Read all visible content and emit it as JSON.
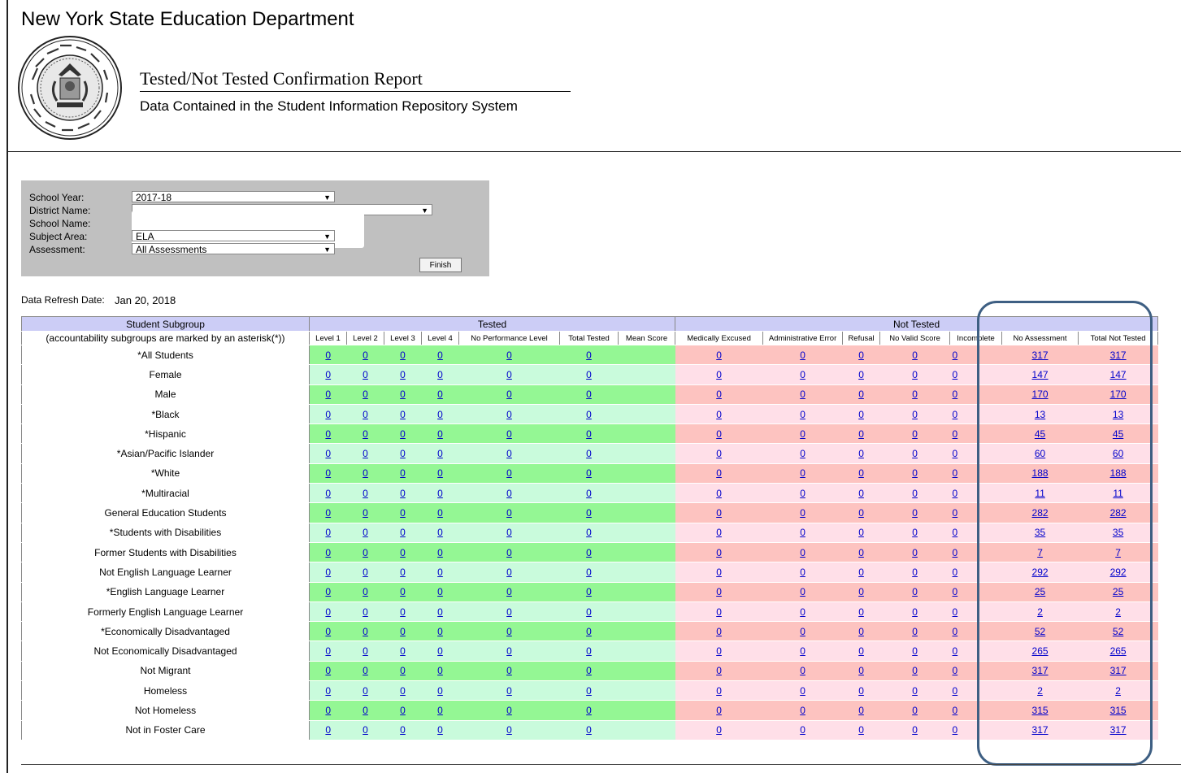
{
  "header": {
    "agency": "New York State Education Department",
    "report_title": "Tested/Not Tested Confirmation Report",
    "report_subtitle": "Data Contained in the Student Information Repository System"
  },
  "filters": {
    "school_year_label": "School Year:",
    "school_year_value": "2017-18",
    "district_label": "District Name:",
    "school_label": "School Name:",
    "subject_label": "Subject Area:",
    "subject_value": "ELA",
    "assessment_label": "Assessment:",
    "assessment_value": "All Assessments",
    "finish_label": "Finish"
  },
  "refresh": {
    "label": "Data Refresh Date:",
    "value": "Jan 20, 2018"
  },
  "table": {
    "group_headers": {
      "subgroup": "Student Subgroup",
      "tested": "Tested",
      "not_tested": "Not Tested"
    },
    "subgroup_note": "(accountability subgroups are marked by an asterisk(*))",
    "columns": [
      "Level 1",
      "Level 2",
      "Level 3",
      "Level 4",
      "No Performance Level",
      "Total Tested",
      "Mean Score",
      "Medically Excused",
      "Administrative Error",
      "Refusal",
      "No Valid Score",
      "Incomplete",
      "No Assessment",
      "Total Not Tested"
    ],
    "rows": [
      {
        "label": "*All Students",
        "values": [
          "0",
          "0",
          "0",
          "0",
          "0",
          "0",
          "",
          "0",
          "0",
          "0",
          "0",
          "0",
          "317",
          "317"
        ]
      },
      {
        "label": "Female",
        "values": [
          "0",
          "0",
          "0",
          "0",
          "0",
          "0",
          "",
          "0",
          "0",
          "0",
          "0",
          "0",
          "147",
          "147"
        ]
      },
      {
        "label": "Male",
        "values": [
          "0",
          "0",
          "0",
          "0",
          "0",
          "0",
          "",
          "0",
          "0",
          "0",
          "0",
          "0",
          "170",
          "170"
        ]
      },
      {
        "label": "*Black",
        "values": [
          "0",
          "0",
          "0",
          "0",
          "0",
          "0",
          "",
          "0",
          "0",
          "0",
          "0",
          "0",
          "13",
          "13"
        ]
      },
      {
        "label": "*Hispanic",
        "values": [
          "0",
          "0",
          "0",
          "0",
          "0",
          "0",
          "",
          "0",
          "0",
          "0",
          "0",
          "0",
          "45",
          "45"
        ]
      },
      {
        "label": "*Asian/Pacific Islander",
        "values": [
          "0",
          "0",
          "0",
          "0",
          "0",
          "0",
          "",
          "0",
          "0",
          "0",
          "0",
          "0",
          "60",
          "60"
        ]
      },
      {
        "label": "*White",
        "values": [
          "0",
          "0",
          "0",
          "0",
          "0",
          "0",
          "",
          "0",
          "0",
          "0",
          "0",
          "0",
          "188",
          "188"
        ]
      },
      {
        "label": "*Multiracial",
        "values": [
          "0",
          "0",
          "0",
          "0",
          "0",
          "0",
          "",
          "0",
          "0",
          "0",
          "0",
          "0",
          "11",
          "11"
        ]
      },
      {
        "label": "General Education Students",
        "values": [
          "0",
          "0",
          "0",
          "0",
          "0",
          "0",
          "",
          "0",
          "0",
          "0",
          "0",
          "0",
          "282",
          "282"
        ]
      },
      {
        "label": "*Students with Disabilities",
        "values": [
          "0",
          "0",
          "0",
          "0",
          "0",
          "0",
          "",
          "0",
          "0",
          "0",
          "0",
          "0",
          "35",
          "35"
        ]
      },
      {
        "label": "Former Students with Disabilities",
        "values": [
          "0",
          "0",
          "0",
          "0",
          "0",
          "0",
          "",
          "0",
          "0",
          "0",
          "0",
          "0",
          "7",
          "7"
        ]
      },
      {
        "label": "Not English Language Learner",
        "values": [
          "0",
          "0",
          "0",
          "0",
          "0",
          "0",
          "",
          "0",
          "0",
          "0",
          "0",
          "0",
          "292",
          "292"
        ]
      },
      {
        "label": "*English Language Learner",
        "values": [
          "0",
          "0",
          "0",
          "0",
          "0",
          "0",
          "",
          "0",
          "0",
          "0",
          "0",
          "0",
          "25",
          "25"
        ]
      },
      {
        "label": "Formerly English Language Learner",
        "values": [
          "0",
          "0",
          "0",
          "0",
          "0",
          "0",
          "",
          "0",
          "0",
          "0",
          "0",
          "0",
          "2",
          "2"
        ]
      },
      {
        "label": "*Economically Disadvantaged",
        "values": [
          "0",
          "0",
          "0",
          "0",
          "0",
          "0",
          "",
          "0",
          "0",
          "0",
          "0",
          "0",
          "52",
          "52"
        ]
      },
      {
        "label": "Not Economically Disadvantaged",
        "values": [
          "0",
          "0",
          "0",
          "0",
          "0",
          "0",
          "",
          "0",
          "0",
          "0",
          "0",
          "0",
          "265",
          "265"
        ]
      },
      {
        "label": "Not Migrant",
        "values": [
          "0",
          "0",
          "0",
          "0",
          "0",
          "0",
          "",
          "0",
          "0",
          "0",
          "0",
          "0",
          "317",
          "317"
        ]
      },
      {
        "label": "Homeless",
        "values": [
          "0",
          "0",
          "0",
          "0",
          "0",
          "0",
          "",
          "0",
          "0",
          "0",
          "0",
          "0",
          "2",
          "2"
        ]
      },
      {
        "label": "Not Homeless",
        "values": [
          "0",
          "0",
          "0",
          "0",
          "0",
          "0",
          "",
          "0",
          "0",
          "0",
          "0",
          "0",
          "315",
          "315"
        ]
      },
      {
        "label": "Not in Foster Care",
        "values": [
          "0",
          "0",
          "0",
          "0",
          "0",
          "0",
          "",
          "0",
          "0",
          "0",
          "0",
          "0",
          "317",
          "317"
        ]
      }
    ]
  },
  "colors": {
    "highlight_border": "#3e5f83",
    "tested_dark": "#94f794",
    "tested_light": "#c9fbdc",
    "not_tested_dark": "#fdc3c0",
    "not_tested_light": "#ffdfe8",
    "link": "#0000cc"
  }
}
